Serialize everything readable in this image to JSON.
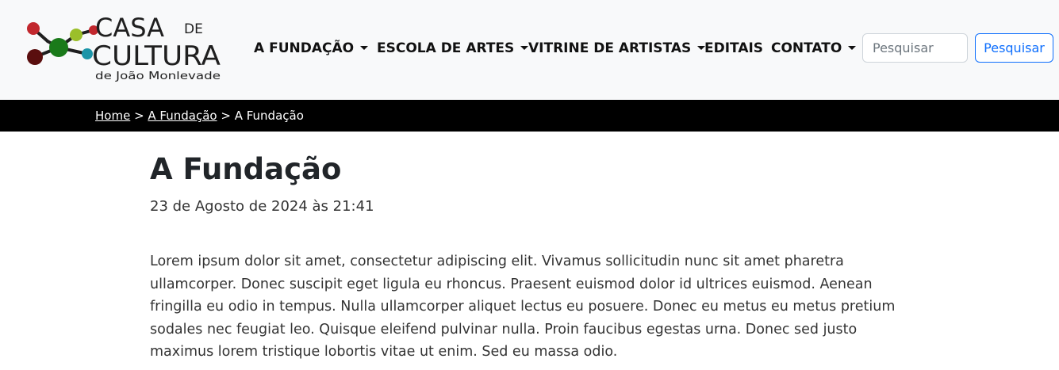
{
  "logo": {
    "line1": "CASA",
    "line1_small": "DE",
    "line2": "CULTURA",
    "line3": "de João Monlevade",
    "colors": {
      "dark_red": "#5a0e0e",
      "red": "#c1272d",
      "green": "#1a7a1a",
      "yellow_green": "#9bbf2a",
      "teal": "#1b95a8",
      "dark": "#1f1f1f"
    }
  },
  "nav": {
    "items": [
      {
        "label": "A FUNDAÇÃO",
        "has_dropdown": true
      },
      {
        "label": "ESCOLA DE ARTES",
        "has_dropdown": true
      },
      {
        "label": "VITRINE DE ARTISTAS",
        "has_dropdown": true
      },
      {
        "label": "EDITAIS",
        "has_dropdown": false
      },
      {
        "label": "CONTATO",
        "has_dropdown": true
      }
    ],
    "search_placeholder": "Pesquisar",
    "search_value": "",
    "search_button": "Pesquisar",
    "accent": "#0d6efd"
  },
  "breadcrumb": {
    "home": "Home",
    "sep1": " > ",
    "parent": "A Fundação",
    "sep2": " > ",
    "current": "A Fundação"
  },
  "article": {
    "title": "A Fundação",
    "date": "23 de Agosto de 2024 às 21:41",
    "body": "Lorem ipsum dolor sit amet, consectetur adipiscing elit. Vivamus sollicitudin nunc sit amet pharetra ullamcorper. Donec suscipit eget ligula eu rhoncus. Praesent euismod dolor id ultrices euismod. Aenean fringilla eu odio in tempus. Nulla ullamcorper aliquet lectus eu posuere. Donec eu metus eu metus pretium sodales nec feugiat leo. Quisque eleifend pulvinar nulla. Proin faucibus egestas urna. Donec sed justo maximus lorem tristique lobortis vitae ut enim. Sed eu massa odio."
  }
}
